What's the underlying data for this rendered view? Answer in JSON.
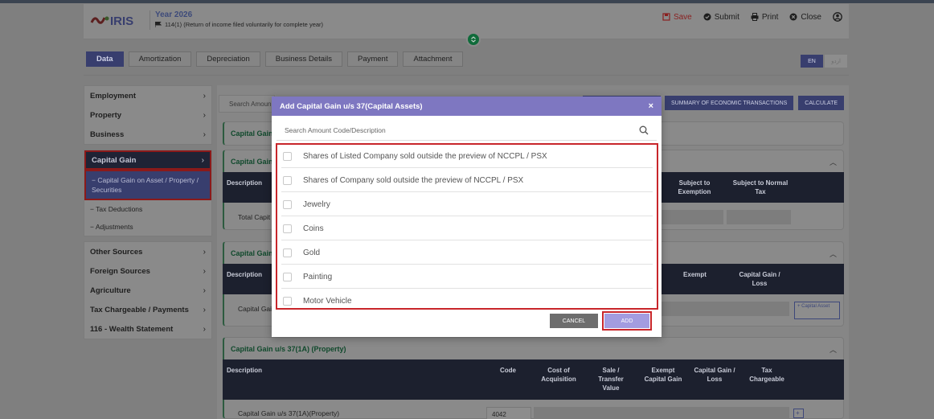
{
  "header": {
    "logo_text": "IRIS",
    "year": "Year 2026",
    "subtitle": "114(1) (Return of income filed voluntarily for complete year)",
    "buttons": {
      "save": "Save",
      "submit": "Submit",
      "print": "Print",
      "close": "Close"
    }
  },
  "tabs": [
    "Data",
    "Amortization",
    "Depreciation",
    "Business Details",
    "Payment",
    "Attachment"
  ],
  "lang": {
    "en": "EN",
    "ur": "اردو"
  },
  "sidebar": {
    "group1": [
      {
        "label": "Employment",
        "chevron": "›"
      },
      {
        "label": "Property",
        "chevron": "›"
      },
      {
        "label": "Business",
        "chevron": "›"
      }
    ],
    "capital_gain": {
      "label": "Capital Gain",
      "chevron": "›"
    },
    "capital_subs": [
      "− Capital Gain on Asset / Property / Securities",
      "− Tax Deductions",
      "− Adjustments"
    ],
    "group3": [
      {
        "label": "Other Sources",
        "chevron": "›"
      },
      {
        "label": "Foreign Sources",
        "chevron": "›"
      },
      {
        "label": "Agriculture",
        "chevron": "›"
      },
      {
        "label": "Tax Chargeable / Payments",
        "chevron": "›"
      },
      {
        "label": "116 - Wealth Statement",
        "chevron": "›"
      }
    ]
  },
  "main": {
    "search_placeholder": "Search Amoun",
    "actions": [
      "SUMMARY OF ECONOMIC TRANSACTIONS",
      "CALCULATE"
    ],
    "card1_title": "Capital Gain",
    "card2_title": "Capital Gain/",
    "card2_headers": {
      "desc": "Description",
      "exempt": "Subject to Exemption",
      "normal": "Subject to Normal Tax"
    },
    "card2_row": "Total Capit",
    "card3_title": "Capital Gain",
    "card3_headers": {
      "desc": "Description",
      "exempt": "Exempt",
      "gain": "Capital Gain / Loss"
    },
    "card3_row": "Capital Gai",
    "card3_button": "+ Capital Asset",
    "card4_title": "Capital Gain u/s 37(1A) (Property)",
    "card4_headers": {
      "desc": "Description",
      "code": "Code",
      "cost": "Cost of Acquisition",
      "sale": "Sale / Transfer Value",
      "exempt": "Exempt Capital Gain",
      "gain": "Capital Gain / Loss",
      "tax": "Tax Chargeable"
    },
    "card4_row": {
      "label": "Capital Gain u/s 37(1A)(Property)",
      "code": "4042",
      "button": "+"
    }
  },
  "modal": {
    "title": "Add Capital Gain u/s 37(Capital Assets)",
    "close": "×",
    "search_placeholder": "Search Amount Code/Description",
    "items": [
      "Shares of Listed Company sold outside the preview of NCCPL / PSX",
      "Shares of Company sold outside the preview of NCCPL / PSX",
      "Jewelry",
      "Coins",
      "Gold",
      "Painting",
      "Motor Vehicle"
    ],
    "cancel": "CANCEL",
    "add": "ADD"
  }
}
